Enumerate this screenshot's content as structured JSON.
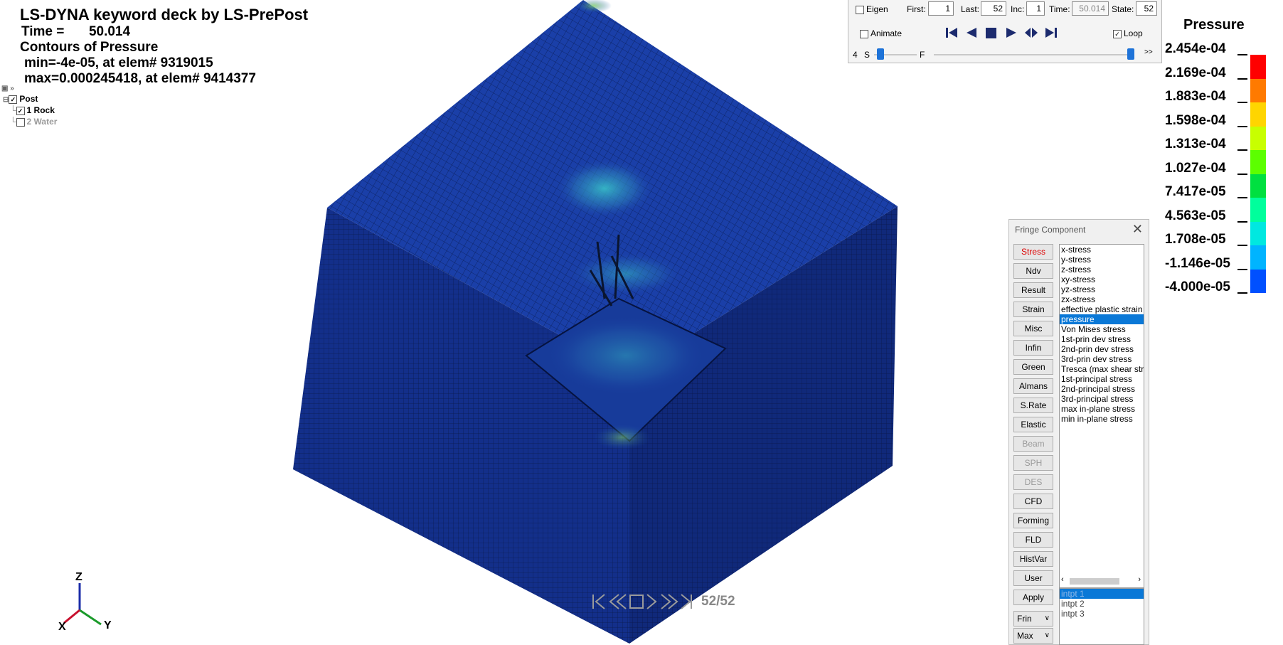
{
  "header": {
    "title": "LS-DYNA keyword deck by LS-PrePost",
    "time_label": "Time =",
    "time_value": "50.014",
    "contours": "Contours of Pressure",
    "min_line": "min=-4e-05, at elem# 9319015",
    "max_line": "max=0.000245418, at elem# 9414377"
  },
  "tree": {
    "root": "Post",
    "items": [
      {
        "label": "1 Rock",
        "checked": true
      },
      {
        "label": "2 Water",
        "checked": false
      }
    ]
  },
  "anim_panel": {
    "eigen_label": "Eigen",
    "first_label": "First:",
    "first_value": "1",
    "last_label": "Last:",
    "last_value": "52",
    "inc_label": "Inc:",
    "inc_value": "1",
    "time_label": "Time:",
    "time_value": "50.014",
    "state_label": "State:",
    "state_value": "52",
    "animate_label": "Animate",
    "loop_label": "Loop",
    "speed_value": "4",
    "s_label": "S",
    "f_label": "F",
    "more_label": ">>"
  },
  "legend": {
    "title": "Pressure",
    "values": [
      "2.454e-04",
      "2.169e-04",
      "1.883e-04",
      "1.598e-04",
      "1.313e-04",
      "1.027e-04",
      "7.417e-05",
      "4.563e-05",
      "1.708e-05",
      "-1.146e-05",
      "-4.000e-05"
    ],
    "colors": [
      "#ff0000",
      "#ff7a00",
      "#ffd500",
      "#c8ff00",
      "#5cff00",
      "#00e040",
      "#00ff9c",
      "#00e8e0",
      "#00b4ff",
      "#0050ff",
      "#0000ff"
    ]
  },
  "fringe": {
    "title": "Fringe Component",
    "buttons": [
      "Stress",
      "Ndv",
      "Result",
      "Strain",
      "Misc",
      "Infin",
      "Green",
      "Almans",
      "S.Rate",
      "Elastic",
      "Beam",
      "SPH",
      "DES",
      "CFD",
      "Forming",
      "FLD",
      "HistVar",
      "User",
      "Apply"
    ],
    "components": [
      "x-stress",
      "y-stress",
      "z-stress",
      "xy-stress",
      "yz-stress",
      "zx-stress",
      "effective plastic strain",
      "pressure",
      "Von Mises stress",
      "1st-prin dev stress",
      "2nd-prin dev stress",
      "3rd-prin dev stress",
      "Tresca (max shear stress)",
      "1st-principal stress",
      "2nd-principal stress",
      "3rd-principal stress",
      "max in-plane stress",
      "min in-plane stress"
    ],
    "selected_component": "pressure",
    "intpts": [
      "intpt 1",
      "intpt 2",
      "intpt 3"
    ],
    "frin_label": "Frin",
    "max_label": "Max"
  },
  "viewport": {
    "frame_counter": "52/52",
    "axes": {
      "z": "Z",
      "x": "X",
      "y": "Y"
    }
  }
}
